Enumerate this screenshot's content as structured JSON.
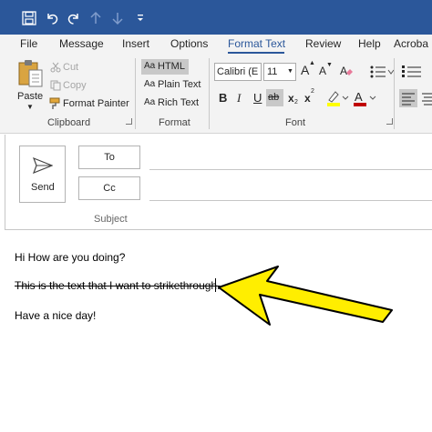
{
  "quick_access": {
    "icons": [
      "save-icon",
      "undo-icon",
      "redo-icon",
      "up-arrow-icon",
      "down-arrow-icon",
      "customize-toolbar-icon"
    ],
    "customize_glyph": "⚲"
  },
  "ribbon_tabs": [
    {
      "label": "File"
    },
    {
      "label": "Message"
    },
    {
      "label": "Insert"
    },
    {
      "label": "Options"
    },
    {
      "label": "Format Text"
    },
    {
      "label": "Review"
    },
    {
      "label": "Help"
    },
    {
      "label": "Acroba"
    }
  ],
  "active_tab": "Format Text",
  "clipboard": {
    "paste": "Paste",
    "cut": "Cut",
    "copy": "Copy",
    "format_painter": "Format Painter",
    "group_label": "Clipboard"
  },
  "format": {
    "html": "HTML",
    "plain_text": "Plain Text",
    "rich_text": "Rich Text",
    "prefix": "Aa",
    "group_label": "Format"
  },
  "font": {
    "family": "Calibri (E",
    "size": "11",
    "group_label": "Font",
    "bold": "B",
    "italic": "I",
    "underline": "U",
    "strikethrough": "ab",
    "subscript": "x",
    "superscript": "x",
    "grow": "A",
    "shrink": "A"
  },
  "compose": {
    "send": "Send",
    "to": "To",
    "cc": "Cc",
    "subject": "Subject"
  },
  "body_lines": [
    "Hi How are you doing?",
    "This is the text that I want to strikethrough.",
    "Have a nice day!"
  ],
  "colors": {
    "title_bar": "#2b579a",
    "ribbon": "#f3f3f3",
    "highlight": "#ffff00",
    "font_color": "#c00000",
    "arrow_fill": "#ffee00"
  }
}
